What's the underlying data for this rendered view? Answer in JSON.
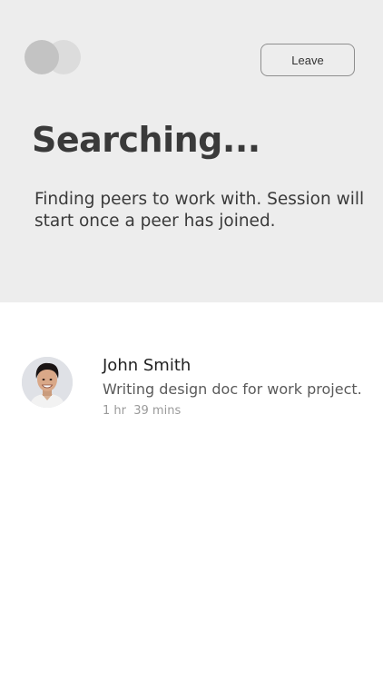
{
  "header": {
    "logo_icon": "two-overlapping-circles-logo",
    "leave_label": "Leave"
  },
  "status": {
    "title": "Searching...",
    "description": "Finding peers to work with. Session will start once a peer has joined."
  },
  "peer": {
    "avatar_icon": "user-avatar-photo",
    "name": "John Smith",
    "task": "Writing design doc for work project.",
    "duration": "1 hr  39 mins"
  },
  "colors": {
    "panel_background": "#ededed",
    "page_background": "#ffffff",
    "text_primary": "#3a3a3a",
    "text_muted": "#9a9a9a",
    "button_border": "#8e8e8e"
  }
}
